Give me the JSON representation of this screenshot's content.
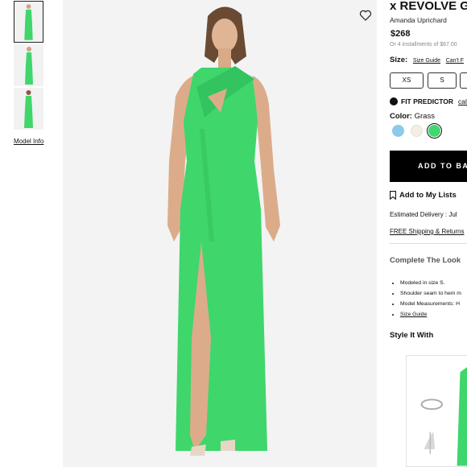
{
  "gallery": {
    "model_info": "Model Info"
  },
  "product": {
    "title": "x REVOLVE Gil",
    "designer": "Amanda Uprichard",
    "price": "$268",
    "installments": "Or 4 installments of $67.00",
    "size_label": "Size:",
    "size_guide": "Size Guide",
    "cant_find": "Can't F",
    "sizes": [
      "XS",
      "S",
      ""
    ],
    "fit_predictor": "FIT PREDICTOR",
    "fit_link": "calc",
    "color_label": "Color:",
    "color_value": "Grass",
    "swatches": [
      "#8ccaea",
      "#f3efe6",
      "#3fd96f"
    ],
    "add_to_bag": "ADD TO BAG",
    "add_to_lists": "Add to My Lists",
    "delivery": "Estimated Delivery : Jul",
    "shipping": "FREE Shipping & Returns",
    "complete_the_look": "Complete The Look",
    "details": [
      "Modeled in size S.",
      "Shoulder seam to hem m",
      "Model Measurements: H",
      "Size Guide"
    ],
    "style_it_with": "Style It With"
  },
  "colors": {
    "dress": "#3fd66c",
    "accent": "#000000"
  }
}
